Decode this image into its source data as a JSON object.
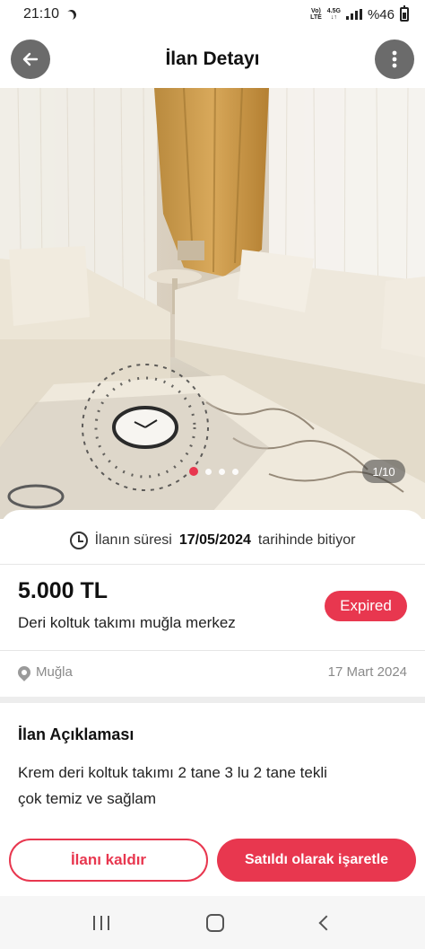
{
  "status_bar": {
    "time": "21:10",
    "network_top": "Vo)",
    "network_bottom": "LTE",
    "gen_top": "4.5G",
    "gen_bottom": "↓↑",
    "battery": "%46",
    "moon_icon": "do-not-disturb-moon-icon"
  },
  "header": {
    "title": "İlan Detayı",
    "back_icon": "arrow-left-icon",
    "more_icon": "more-vertical-icon"
  },
  "gallery": {
    "counter": "1/10",
    "current_index": 1,
    "dot_count": 4
  },
  "listing": {
    "expiry_prefix": "İlanın süresi",
    "expiry_date": "17/05/2024",
    "expiry_suffix": "tarihinde bitiyor",
    "price": "5.000 TL",
    "title": "Deri koltuk takımı muğla merkez",
    "status_badge": "Expired",
    "location": "Muğla",
    "date": "17 Mart 2024"
  },
  "description": {
    "heading": "İlan Açıklaması",
    "line1": "Krem deri koltuk takımı 2 tane 3 lu 2 tane tekli",
    "line2": "çok temiz ve sağlam"
  },
  "actions": {
    "remove_label": "İlanı kaldır",
    "sold_label": "Satıldı olarak işaretle"
  },
  "colors": {
    "accent": "#e8374f",
    "header_button": "#6b6b6b"
  }
}
